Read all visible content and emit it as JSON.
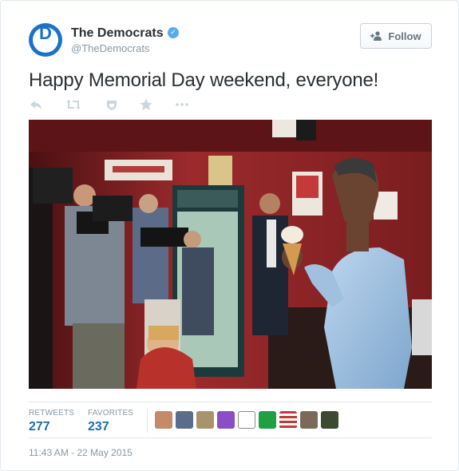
{
  "account": {
    "name": "The Democrats",
    "handle": "@TheDemocrats",
    "avatar_letter": "D",
    "avatar_color": "#1a73c7",
    "verified_icon": "verified-badge-icon"
  },
  "follow_button": {
    "label": "Follow",
    "icon": "add-user-icon"
  },
  "tweet": {
    "text": "Happy Memorial Day weekend, everyone!"
  },
  "actions": [
    {
      "icon": "reply-icon"
    },
    {
      "icon": "retweet-icon"
    },
    {
      "icon": "favorite-icon"
    },
    {
      "icon": "star-icon"
    },
    {
      "icon": "more-icon"
    }
  ],
  "photo": {
    "icon": "tweet-photo"
  },
  "stats": {
    "retweets": {
      "label": "RETWEETS",
      "value": "277"
    },
    "favorites": {
      "label": "FAVORITES",
      "value": "237"
    }
  },
  "timestamp": "11:43 AM - 22 May 2015",
  "colors": {
    "accent": "#1b6fae",
    "muted": "#8899a6",
    "verified": "#55acee"
  }
}
